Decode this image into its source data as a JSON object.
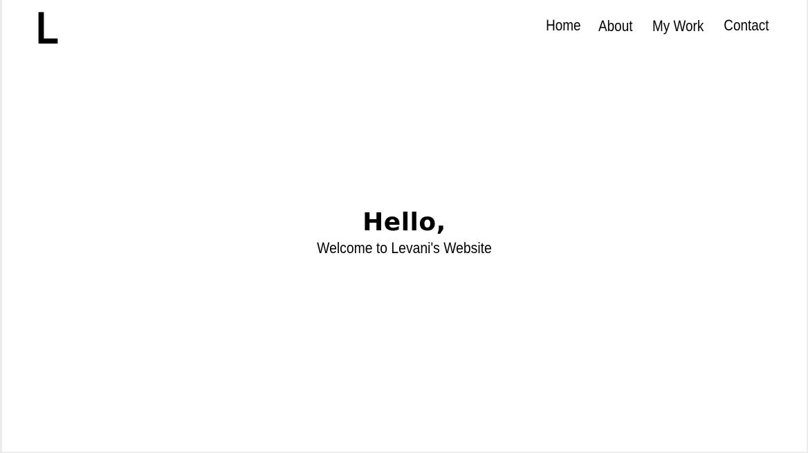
{
  "header": {
    "logo_text": "L",
    "nav": {
      "home": "Home",
      "about": "About",
      "my_work": "My Work",
      "contact": "Contact"
    }
  },
  "hero": {
    "title": "Hello,",
    "subtitle": "Welcome to Levani's Website"
  },
  "colors": {
    "background": "#ffffff",
    "text": "#000000",
    "frame": "#ececec"
  }
}
